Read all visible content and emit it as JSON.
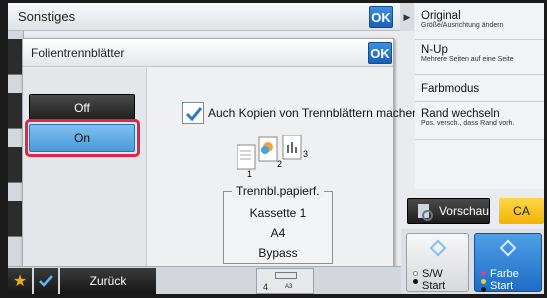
{
  "outer": {
    "title": "Sonstiges",
    "ok_label": "OK"
  },
  "dialog": {
    "title": "Folientrennblätter",
    "ok_label": "OK",
    "off_label": "Off",
    "on_label": "On",
    "selected": "On",
    "checkbox_label": "Auch Kopien von Trennblättern machen",
    "checkbox_checked": true,
    "pages_icon_numbers": [
      "1",
      "2",
      "3"
    ],
    "paper_legend": "Trennbl.papierf.",
    "paper_lines": [
      "Kassette 1",
      "A4",
      "Bypass"
    ]
  },
  "right_panel": {
    "items": [
      {
        "title": "Original",
        "sub": "Größe/Ausrichtung ändern"
      },
      {
        "title": "N-Up",
        "sub": "Mehrere Seiten auf eine Seite"
      },
      {
        "title": "Farbmodus",
        "sub": ""
      },
      {
        "title": "Rand wechseln",
        "sub": "Pos. versch., dass Rand vorh."
      }
    ],
    "preview_label": "Vorschau",
    "ca_label": "CA",
    "bw_start_label": [
      "S/W",
      "Start"
    ],
    "color_start_label": [
      "Farbe",
      "Start"
    ]
  },
  "bottom": {
    "back_label": "Zurück",
    "counter_number": "4",
    "counter_paper": "A3"
  },
  "colors": {
    "accent_blue": "#1a5fb8",
    "on_button": "#6bb2ec",
    "highlight": "#e0244b",
    "ca_yellow": "#f2b400"
  }
}
